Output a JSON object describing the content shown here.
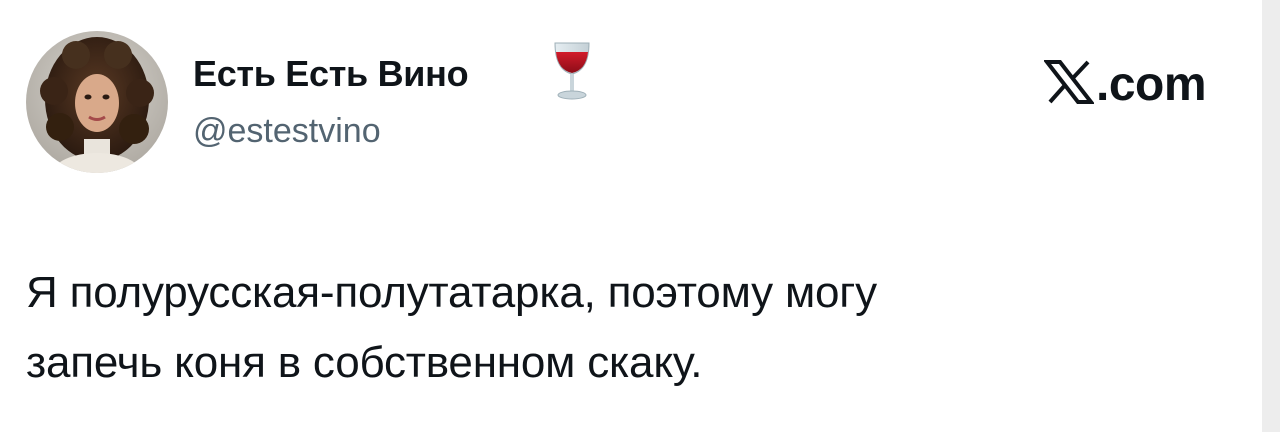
{
  "author": {
    "display_name": "Есть Есть Вино",
    "handle": "@estestvino",
    "name_emoji": "wine-glass-icon"
  },
  "brand": {
    "label": ".com",
    "logo": "x-logo-icon"
  },
  "tweet": {
    "text_lines": [
      "Я полурусская-полутатарка, поэтому могу",
      "запечь коня в собственном скаку."
    ]
  },
  "colors": {
    "text_primary": "#0f1419",
    "text_secondary": "#536471",
    "background": "#ffffff"
  }
}
